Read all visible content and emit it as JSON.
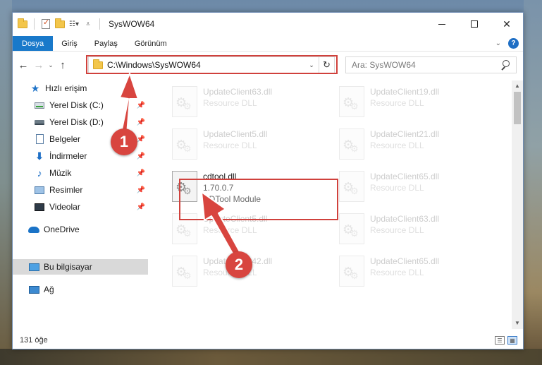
{
  "window": {
    "title": "SysWOW64"
  },
  "ribbon": {
    "tabs": [
      "Dosya",
      "Giriş",
      "Paylaş",
      "Görünüm"
    ],
    "help": "?"
  },
  "address": {
    "path": "C:\\Windows\\SysWOW64"
  },
  "search": {
    "placeholder": "Ara: SysWOW64"
  },
  "sidebar": {
    "items": [
      {
        "label": "Hızlı erişim"
      },
      {
        "label": "Yerel Disk (C:)"
      },
      {
        "label": "Yerel Disk (D:)"
      },
      {
        "label": "Belgeler"
      },
      {
        "label": "İndirmeler"
      },
      {
        "label": "Müzik"
      },
      {
        "label": "Resimler"
      },
      {
        "label": "Videolar"
      },
      {
        "label": "OneDrive"
      },
      {
        "label": "Bu bilgisayar"
      },
      {
        "label": "Ağ"
      }
    ]
  },
  "files": [
    {
      "name": "UpdateClient63.dll",
      "sub": "Resource DLL"
    },
    {
      "name": "UpdateClient19.dll",
      "sub": "Resource DLL"
    },
    {
      "name": "UpdateClient5.dll",
      "sub": "Resource DLL"
    },
    {
      "name": "UpdateClient21.dll",
      "sub": "Resource DLL"
    },
    {
      "name": "cdtool.dll",
      "version": "1.70.0.7",
      "sub": "CDTool Module"
    },
    {
      "name": "UpdateClient65.dll",
      "sub": "Resource DLL"
    },
    {
      "name": "UpdateClient5.dll",
      "sub": "Resource DLL"
    },
    {
      "name": "UpdateClient63.dll",
      "sub": "Resource DLL"
    },
    {
      "name": "UpdateClient42.dll",
      "sub": "Resource DLL"
    },
    {
      "name": "UpdateClient65.dll",
      "sub": "Resource DLL"
    }
  ],
  "status": {
    "count": "131 öğe"
  },
  "annotations": {
    "badge1": "1",
    "badge2": "2"
  },
  "colors": {
    "accent": "#1979ca",
    "highlight": "#d0413c"
  }
}
